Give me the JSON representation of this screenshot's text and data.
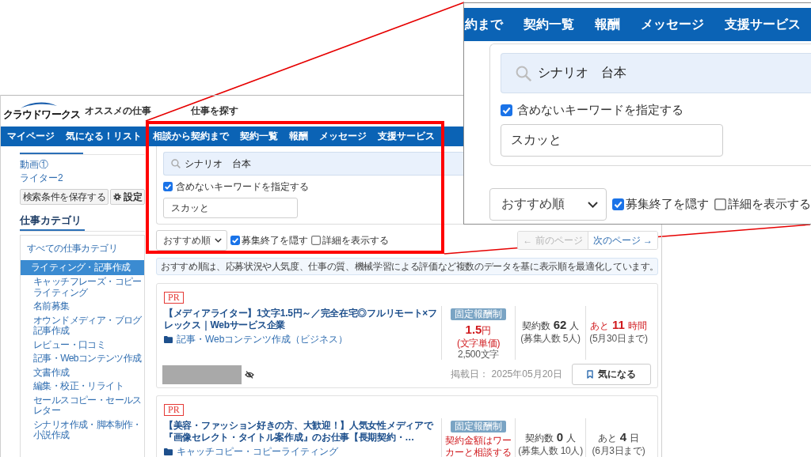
{
  "header": {
    "logo": "クラウドワークス",
    "links": [
      "オススメの仕事",
      "仕事を探す"
    ]
  },
  "nav": {
    "items": [
      "マイページ",
      "気になる！リスト",
      "相談から契約まで",
      "契約一覧",
      "報酬",
      "メッセージ",
      "支援サービス"
    ]
  },
  "sidebar": {
    "saved_searches": [
      "動画①",
      "ライター2"
    ],
    "save_button": "検索条件を保存する",
    "settings_button": "設定",
    "category_heading": "仕事カテゴリ",
    "categories": [
      {
        "label": "すべての仕事カテゴリ",
        "selected": false,
        "children": [
          {
            "label": "ライティング・記事作成",
            "selected": true,
            "children": [
              {
                "label": "キャッチフレーズ・コピーライティング",
                "selected": false
              },
              {
                "label": "名前募集",
                "selected": false
              },
              {
                "label": "オウンドメディア・ブログ記事作成",
                "selected": false
              },
              {
                "label": "レビュー・口コミ",
                "selected": false
              },
              {
                "label": "記事・Webコンテンツ作成",
                "selected": false
              },
              {
                "label": "文書作成",
                "selected": false
              },
              {
                "label": "編集・校正・リライト",
                "selected": false
              },
              {
                "label": "セールスコピー・セールスレター",
                "selected": false
              },
              {
                "label": "シナリオ作成・脚本制作・小説作成",
                "selected": false
              }
            ]
          }
        ]
      }
    ]
  },
  "search": {
    "query": "シナリオ　台本",
    "exclude": {
      "label": "含めないキーワードを指定する",
      "checked": true,
      "value": "スカッと"
    }
  },
  "sort": {
    "value": "おすすめ順",
    "options": [
      {
        "label": "募集終了を隠す",
        "checked": true
      },
      {
        "label": "詳細を表示する",
        "checked": false
      }
    ]
  },
  "pagination": [
    {
      "label": "← 前のページ",
      "disabled": true
    },
    {
      "label": "次のページ →",
      "disabled": false
    }
  ],
  "notice": "おすすめ順は、応募状況や人気度、仕事の質、機械学習による評価など複数のデータを基に表示順を最適化しています。",
  "jobs": [
    {
      "badge": "PR",
      "title": "【メディアライター】1文字1.5円～／完全在宅◎フルリモート×フレックス｜Webサービス企業",
      "category": "記事・Webコンテンツ作成（ビジネス）",
      "pay_type": "固定報酬制",
      "price": {
        "kind": "amount",
        "value": "1.5",
        "unit": "円",
        "note": "(文字単価)",
        "detail": "2,500文字"
      },
      "contracts": {
        "label": "契約数",
        "count": "62",
        "unit": "人",
        "note": "(募集人数 5人)"
      },
      "deadline": {
        "prefix": "あと",
        "value": "11",
        "unit": "時間",
        "note": "(5月30日まで)",
        "urgent": true
      },
      "posted": "掲載日： 2025年05月20日",
      "watch_button": "気になる"
    },
    {
      "badge": "PR",
      "title": "【美容・ファッション好きの方、大歓迎！】人気女性メディアで『画像セレクト・タイトル案作成』のお仕事【長期契約・…",
      "category": "キャッチコピー・コピーライティング",
      "pay_type": "固定報酬制",
      "price": {
        "kind": "negotiable",
        "text": "契約金額はワーカーと相談する"
      },
      "contracts": {
        "label": "契約数",
        "count": "0",
        "unit": "人",
        "note": "(募集人数 10人)"
      },
      "deadline": {
        "prefix": "あと",
        "value": "4",
        "unit": "日",
        "note": "(6月3日まで)",
        "urgent": false
      }
    }
  ],
  "zoom_inset": {
    "nav_items": [
      "約まで",
      "契約一覧",
      "報酬",
      "メッセージ",
      "支援サービス"
    ],
    "search_query": "シナリオ　台本",
    "exclude": {
      "label": "含めないキーワードを指定する",
      "checked": true,
      "value": "スカッと"
    },
    "sort_value": "おすすめ順",
    "options": [
      {
        "label": "募集終了を隠す",
        "checked": true
      },
      {
        "label": "詳細を表示する",
        "checked": false
      }
    ]
  }
}
